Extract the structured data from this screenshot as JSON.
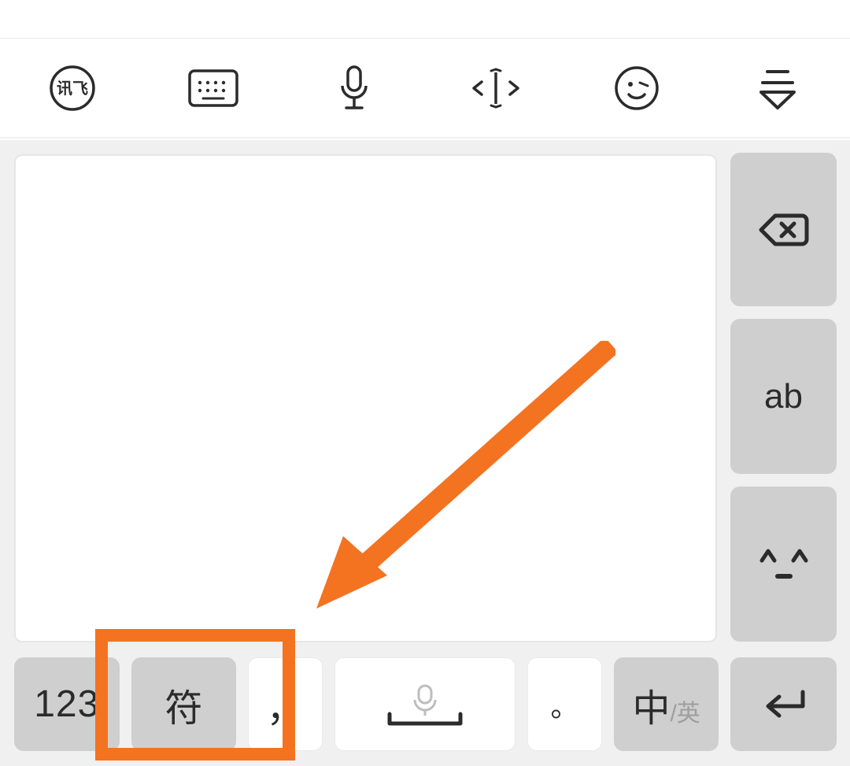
{
  "toolbar": {
    "items": [
      {
        "name": "ime-logo-icon",
        "label": "讯飞"
      },
      {
        "name": "keyboard-layout-icon",
        "label": "键盘布局"
      },
      {
        "name": "mic-icon",
        "label": "语音"
      },
      {
        "name": "cursor-move-icon",
        "label": "光标移动"
      },
      {
        "name": "emoji-icon",
        "label": "表情"
      },
      {
        "name": "collapse-keyboard-icon",
        "label": "收起键盘"
      }
    ]
  },
  "side_keys": {
    "backspace": {
      "name": "backspace-key",
      "label": "⌫"
    },
    "ab": {
      "name": "ab-key",
      "label": "ab"
    },
    "kaomoji": {
      "name": "kaomoji-key",
      "label": "^_^"
    }
  },
  "bottom_keys": {
    "num": {
      "name": "num-key",
      "label": "123"
    },
    "symbol": {
      "name": "symbol-key",
      "label": "符"
    },
    "comma": {
      "name": "comma-key",
      "label": "，"
    },
    "space": {
      "name": "space-key",
      "label": " "
    },
    "period": {
      "name": "period-key",
      "label": "。"
    },
    "lang": {
      "name": "lang-key",
      "label_main": "中",
      "label_sub": "/英"
    },
    "enter": {
      "name": "enter-key",
      "label": "↵"
    }
  },
  "annotation": {
    "arrow_color": "#F37321",
    "highlight_color": "#F37321",
    "highlighted_key": "symbol-key"
  }
}
